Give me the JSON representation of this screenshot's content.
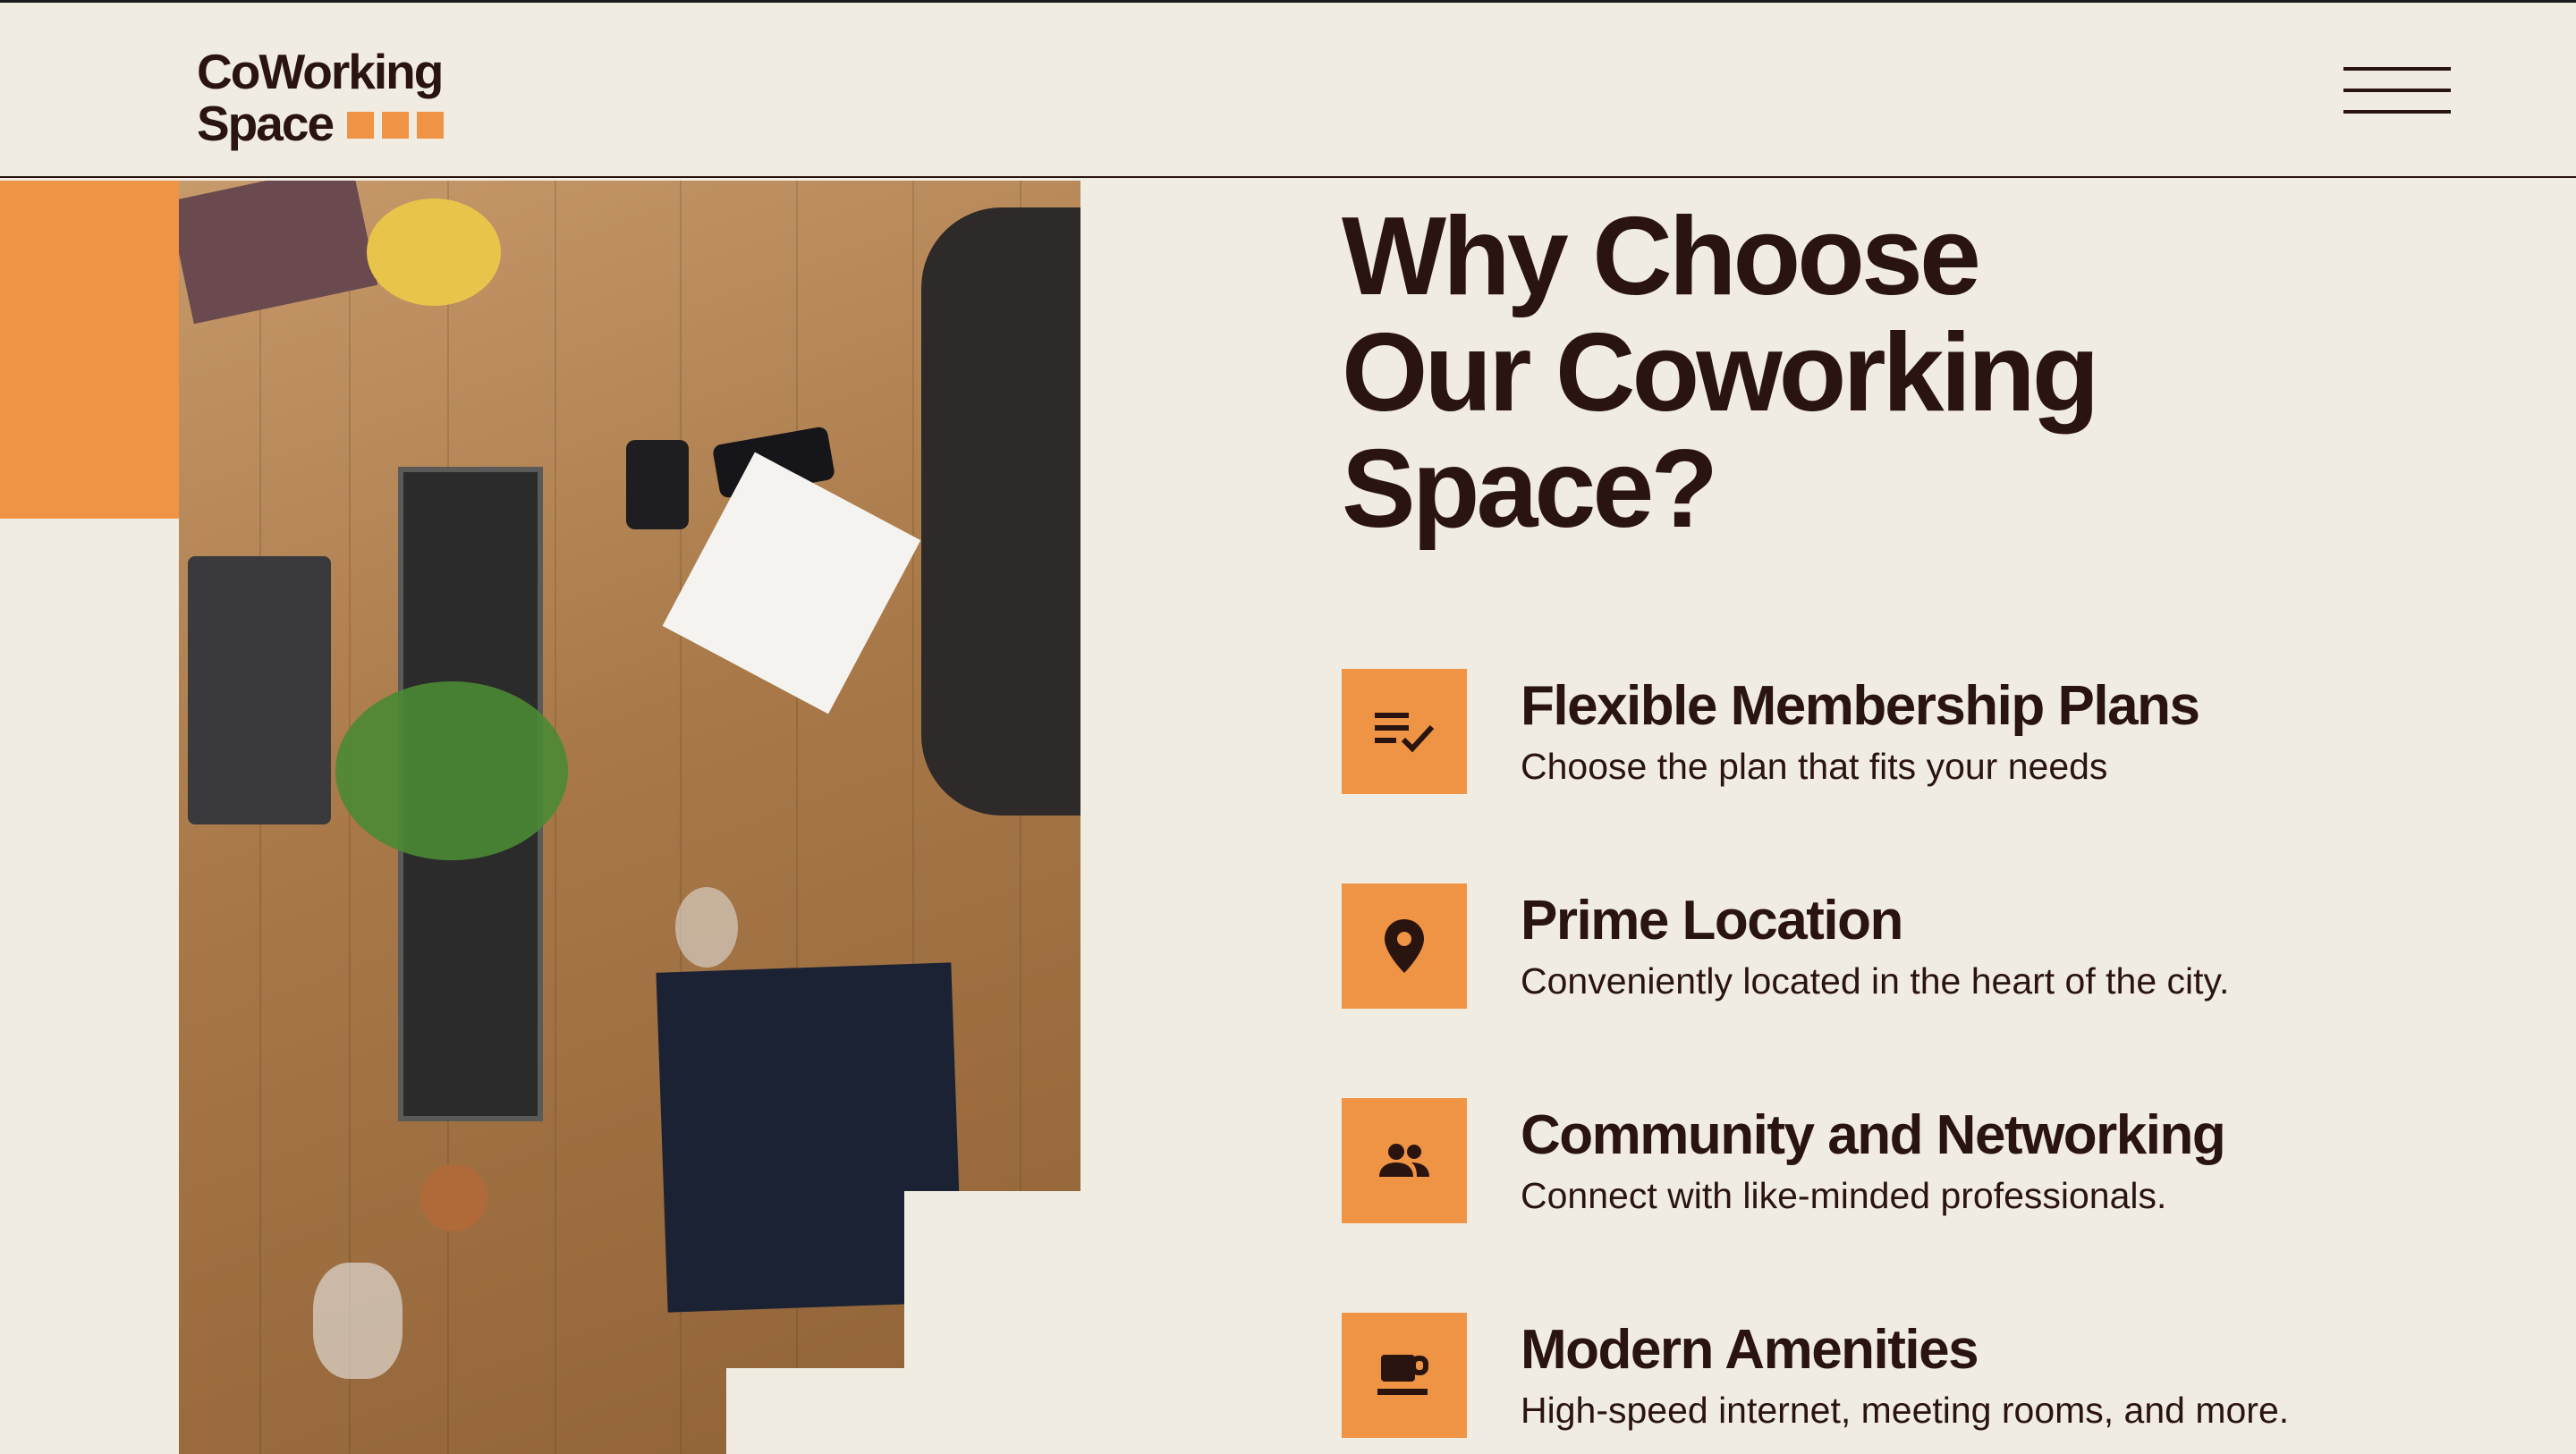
{
  "header": {
    "logo_line1": "CoWorking",
    "logo_line2": "Space",
    "menu_icon": "hamburger-menu-icon"
  },
  "hero_image": {
    "description_icon": "coworking-table-photo"
  },
  "section": {
    "title_line1": "Why Choose",
    "title_line2": "Our Coworking",
    "title_line3": "Space?"
  },
  "features": [
    {
      "icon": "checklist-icon",
      "title": "Flexible Membership Plans",
      "description": "Choose the plan that fits your needs"
    },
    {
      "icon": "location-pin-icon",
      "title": "Prime Location",
      "description": "Conveniently located in the heart of the city."
    },
    {
      "icon": "people-icon",
      "title": "Community and Networking",
      "description": "Connect with like-minded professionals."
    },
    {
      "icon": "coffee-cup-icon",
      "title": "Modern Amenities",
      "description": "High-speed internet, meeting rooms, and more."
    }
  ],
  "colors": {
    "background": "#f1ece2",
    "accent": "#ef9444",
    "text": "#2a1410"
  }
}
